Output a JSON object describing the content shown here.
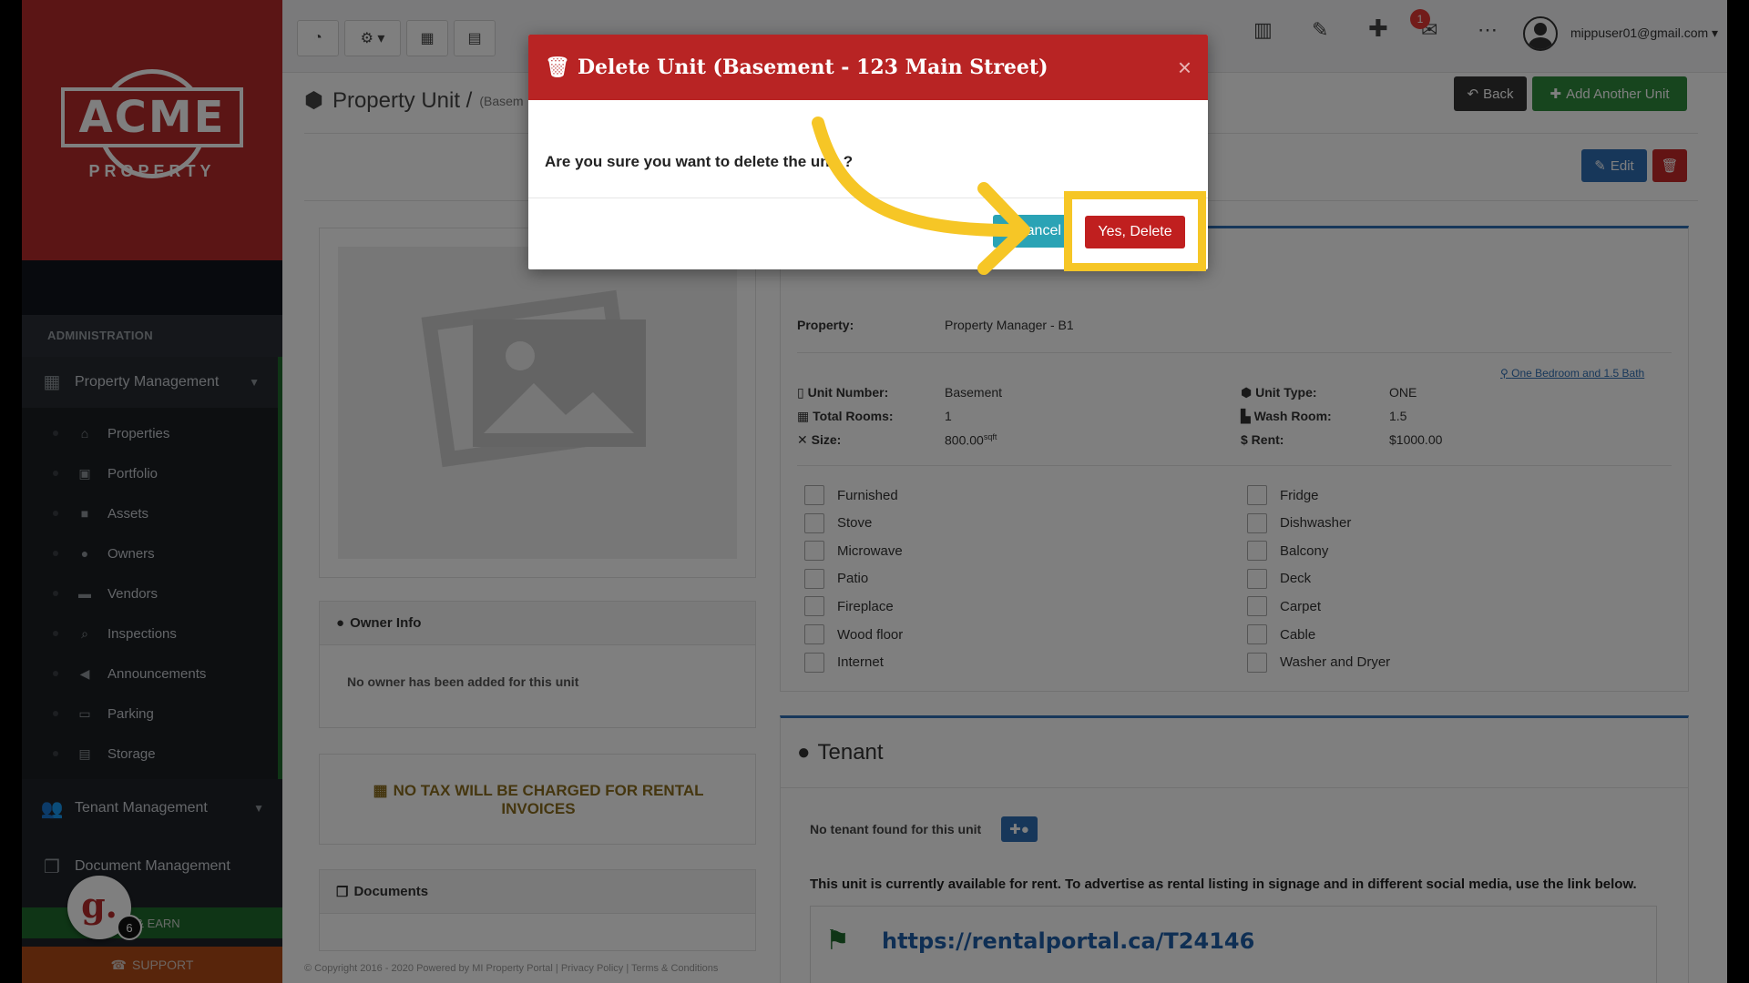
{
  "sidebar": {
    "logo_text": "ACME",
    "logo_sub": "PROPERTY",
    "section_label": "ADMINISTRATION",
    "group1_label": "Property Management",
    "items": [
      "Properties",
      "Portfolio",
      "Assets",
      "Owners",
      "Vendors",
      "Inspections",
      "Announcements",
      "Parking",
      "Storage"
    ],
    "group2_label": "Tenant Management",
    "group3_label": "Document Management",
    "refer_label": "R & EARN",
    "support_label": "SUPPORT",
    "g_letter": "g.",
    "g_count": "6"
  },
  "topbar": {
    "notification_count": "1",
    "user_email": "mippuser01@gmail.com"
  },
  "page": {
    "title": "Property Unit /",
    "crumb": "(Basem",
    "back_label": "Back",
    "add_unit_label": "Add Another Unit",
    "edit_label": "Edit"
  },
  "owner": {
    "heading": "Owner Info",
    "empty": "No owner has been added for this unit"
  },
  "tax_notice": "NO TAX WILL BE CHARGED FOR RENTAL INVOICES",
  "documents_heading": "Documents",
  "details": {
    "property_label": "Property:",
    "property_value": "Property Manager - B1",
    "layout_link": "One Bedroom and 1.5 Bath",
    "unit_number_label": "Unit Number:",
    "unit_number_value": "Basement",
    "total_rooms_label": "Total Rooms:",
    "total_rooms_value": "1",
    "size_label": "Size:",
    "size_value": "800.00",
    "size_unit": "sqft",
    "unit_type_label": "Unit Type:",
    "unit_type_value": "ONE",
    "wash_room_label": "Wash Room:",
    "wash_room_value": "1.5",
    "rent_label": "$ Rent:",
    "rent_value": "$1000.00"
  },
  "amenities_left": [
    "Furnished",
    "Stove",
    "Microwave",
    "Patio",
    "Fireplace",
    "Wood floor",
    "Internet"
  ],
  "amenities_right": [
    "Fridge",
    "Dishwasher",
    "Balcony",
    "Deck",
    "Carpet",
    "Cable",
    "Washer and Dryer"
  ],
  "tenant": {
    "heading": "Tenant",
    "empty": "No tenant found for this unit",
    "availability": "This unit is currently available for rent. To advertise as rental listing in signage and in different social media, use the link below.",
    "link": "https://rentalportal.ca/T24146"
  },
  "footer": "© Copyright 2016 - 2020 Powered by MI Property Portal | Privacy Policy | Terms & Conditions",
  "modal": {
    "title": "Delete Unit (Basement - 123 Main Street)",
    "message": "Are you sure you want to delete the unit ?",
    "cancel_label": "Cancel",
    "confirm_label": "Yes, Delete"
  },
  "colors": {
    "brand_red": "#b72a2a",
    "accent_yellow": "#f6c626",
    "success_green": "#2e8b3d",
    "primary_blue": "#2f6fb5"
  }
}
